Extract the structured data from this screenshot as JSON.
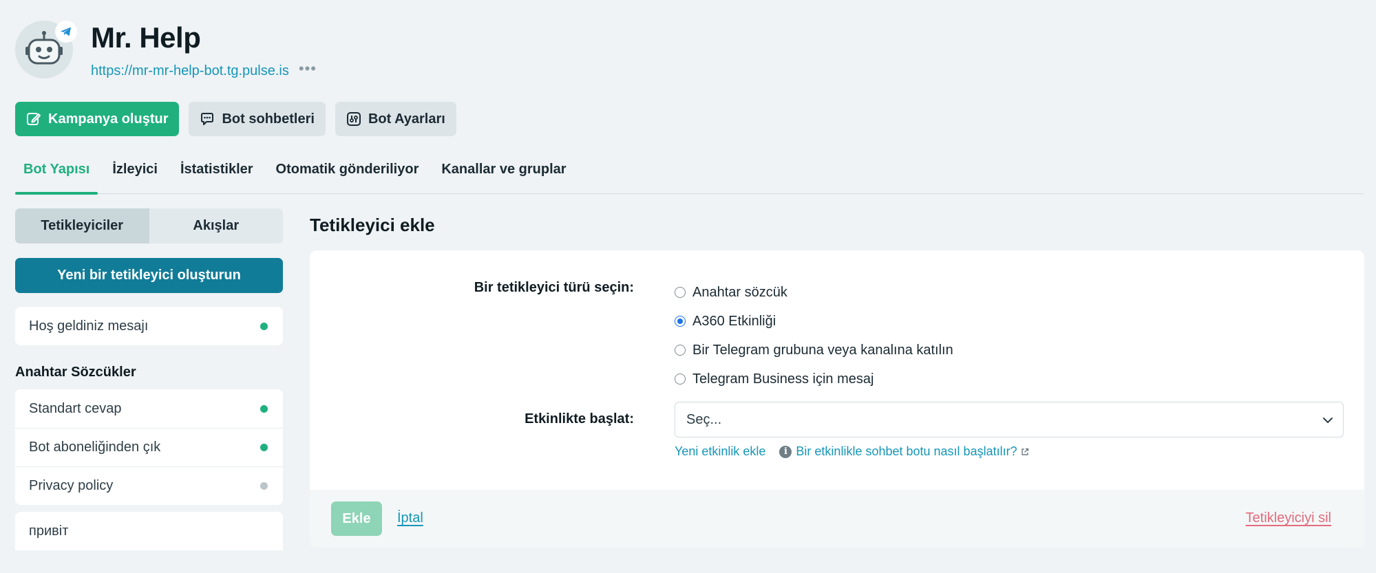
{
  "header": {
    "title": "Mr. Help",
    "url": "https://mr-mr-help-bot.tg.pulse.is",
    "more": "•••"
  },
  "actions": {
    "create_campaign": "Kampanya oluştur",
    "bot_chats": "Bot sohbetleri",
    "bot_settings": "Bot Ayarları"
  },
  "tabs": [
    {
      "label": "Bot Yapısı"
    },
    {
      "label": "İzleyici"
    },
    {
      "label": "İstatistikler"
    },
    {
      "label": "Otomatik gönderiliyor"
    },
    {
      "label": "Kanallar ve gruplar"
    }
  ],
  "sidebar": {
    "segment_triggers": "Tetikleyiciler",
    "segment_flows": "Akışlar",
    "create_trigger": "Yeni bir tetikleyici oluşturun",
    "welcome": "Hoş geldiniz mesajı",
    "keywords_title": "Anahtar Sözcükler",
    "keywords": [
      {
        "label": "Standart cevap"
      },
      {
        "label": "Bot aboneliğinden çık"
      },
      {
        "label": "Privacy policy"
      }
    ],
    "partial_item": "привіт"
  },
  "panel": {
    "title": "Tetikleyici ekle",
    "type_label": "Bir tetikleyici türü seçin:",
    "options": [
      {
        "label": "Anahtar sözcük"
      },
      {
        "label": "A360 Etkinliği"
      },
      {
        "label": "Bir Telegram grubuna veya kanalına katılın"
      },
      {
        "label": "Telegram Business için mesaj"
      }
    ],
    "selected_option": "A360 Etkinliği",
    "event_label": "Etkinlikte başlat:",
    "select_placeholder": "Seç...",
    "new_event_link": "Yeni etkinlik ekle",
    "help_link": "Bir etkinlikle sohbet botu nasıl başlatılır?",
    "add_button": "Ekle",
    "cancel_link": "İptal",
    "delete_link": "Tetikleyiciyi sil"
  }
}
